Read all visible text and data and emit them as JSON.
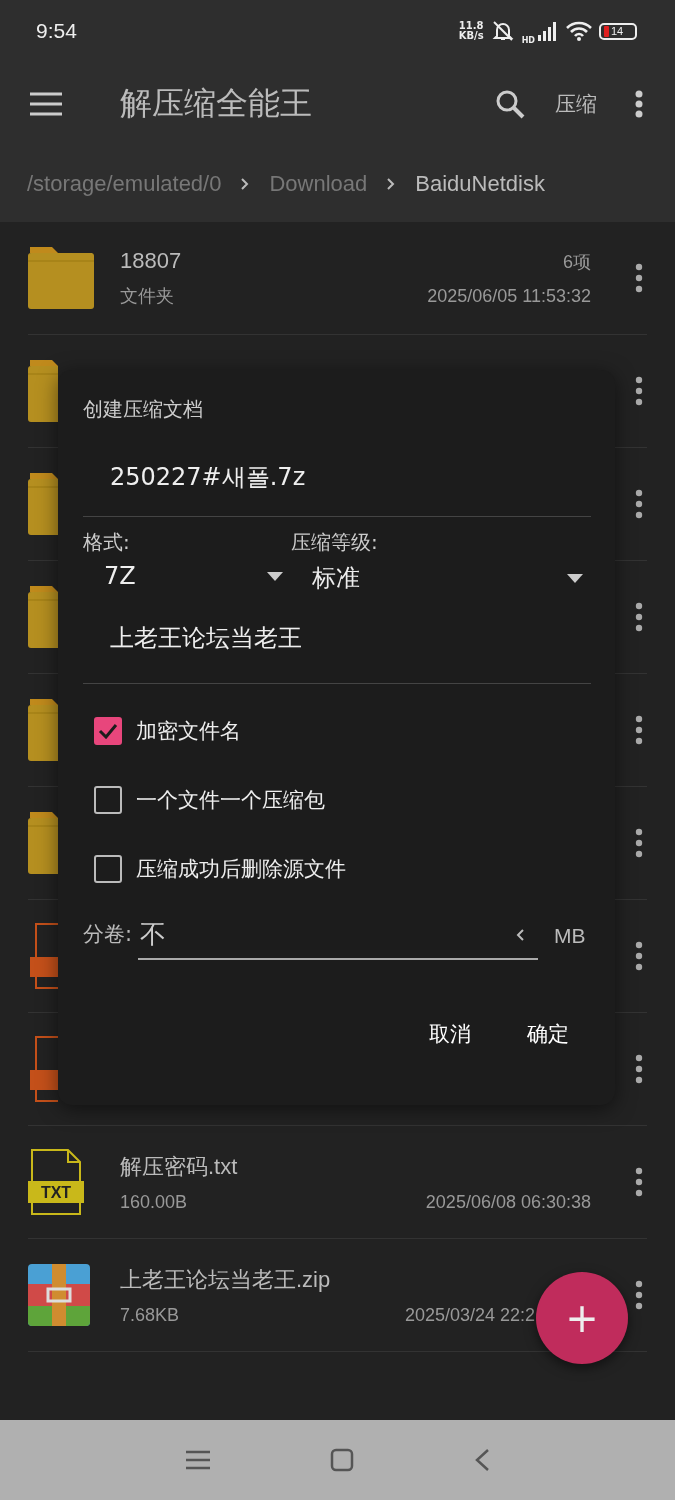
{
  "status_bar": {
    "time": "9:54",
    "net_speed": [
      "11.8",
      "KB/s"
    ],
    "network_type": "HD",
    "battery": "14"
  },
  "app_bar": {
    "title": "解压缩全能王",
    "action": "压缩"
  },
  "breadcrumb": [
    {
      "label": "/storage/emulated/0",
      "selected": false
    },
    {
      "label": "Download",
      "selected": false
    },
    {
      "label": "BaiduNetdisk",
      "selected": true
    }
  ],
  "files": [
    {
      "kind": "folder",
      "name": "18807",
      "type": "文件夹",
      "count": "6项",
      "date": "2025/06/05 11:53:32"
    },
    {
      "kind": "folder"
    },
    {
      "kind": "folder"
    },
    {
      "kind": "folder"
    },
    {
      "kind": "folder"
    },
    {
      "kind": "folder"
    },
    {
      "kind": "sevenzip"
    },
    {
      "kind": "rar"
    },
    {
      "kind": "txt",
      "badge": "TXT",
      "name": "解压密码.txt",
      "size": "160.00B",
      "date": "2025/06/08 06:30:38"
    },
    {
      "kind": "zip",
      "name": "上老王论坛当老王.zip",
      "size": "7.68KB",
      "date": "2025/03/24 22:2"
    }
  ],
  "dialog": {
    "title": "创建压缩文档",
    "filename": "250227#새폴.7z",
    "format_label": "格式:",
    "format": "7Z",
    "level_label": "压缩等级:",
    "level": "标准",
    "password": "上老王论坛当老王",
    "options": [
      {
        "label": "加密文件名",
        "checked": true
      },
      {
        "label": "一个文件一个压缩包",
        "checked": false
      },
      {
        "label": "压缩成功后删除源文件",
        "checked": false
      }
    ],
    "split_label": "分卷:",
    "split": "不",
    "split_unit": "MB",
    "buttons": [
      "取消",
      "确定"
    ]
  },
  "fab": "+"
}
